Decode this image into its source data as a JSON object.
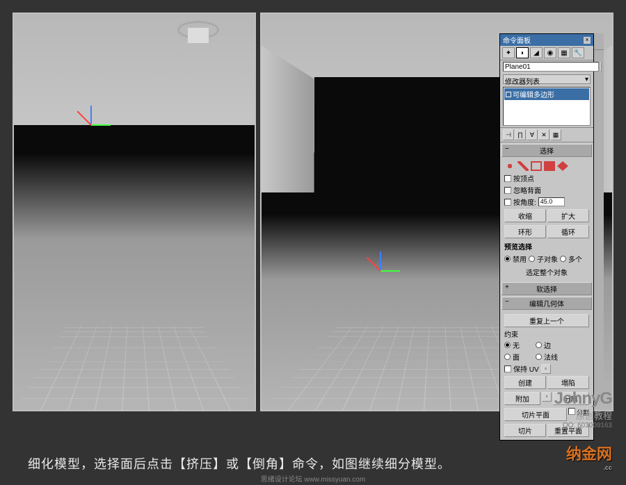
{
  "panel": {
    "title": "命令面板",
    "object_name": "Plane01",
    "modifier_list": "修改器列表",
    "current_modifier": "可编辑多边形",
    "sections": {
      "selection": "选择",
      "soft_selection": "软选择",
      "edit_geometry": "编辑几何体"
    },
    "selection_opts": {
      "by_vertex": "按顶点",
      "ignore_backfacing": "忽略背面",
      "by_angle": "按角度:",
      "angle_value": "45.0",
      "shrink": "收缩",
      "grow": "扩大",
      "ring": "环形",
      "loop": "循环",
      "preview_label": "预览选择",
      "disable": "禁用",
      "sub_object": "子对象",
      "multiple": "多个",
      "select_whole": "选定整个对象"
    },
    "edit_geo": {
      "repeat_last": "重复上一个",
      "constraints": "约束",
      "none": "无",
      "edge": "边",
      "face": "面",
      "normal": "法线",
      "preserve_uv": "保持 UV",
      "create": "创建",
      "collapse": "塌陷",
      "attach": "附加",
      "detach": "分离",
      "slice_plane": "切片平面",
      "split": "分割",
      "slice": "切片",
      "reset_plane": "重置平面"
    }
  },
  "caption": "细化模型，选择面后点击【挤压】或【倒角】命令，如图继续细分模型。",
  "watermark": {
    "name": "JohnyG",
    "sub": "原创教程",
    "qq": "QQ: 603009163"
  },
  "logo": {
    "main": "纳金网",
    "sub": ".cc"
  },
  "footer": "思绪设计论坛 www.missyuan.com"
}
